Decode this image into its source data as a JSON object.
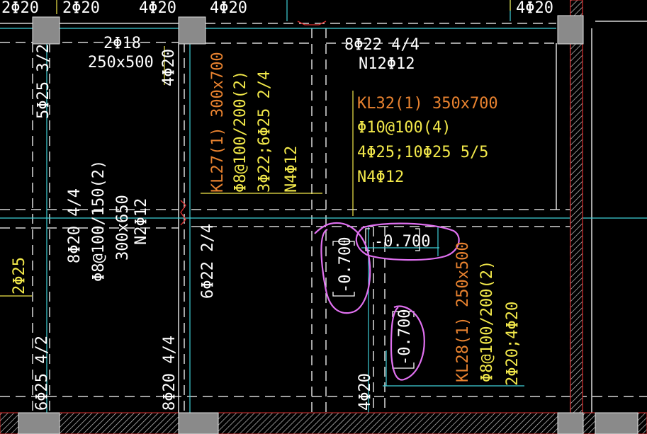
{
  "colors": {
    "background": "#000000",
    "white": "#ffffff",
    "orange": "#e8822f",
    "yellow": "#f2e84a",
    "cyan": "#3fd0d8",
    "red": "#e03030",
    "magenta": "#e070f0",
    "column_fill": "#8a8a8a"
  },
  "top_labels": {
    "a": "2Φ20",
    "b": "2Φ20",
    "c": "4Φ20",
    "d": "4Φ20"
  },
  "beam_left": {
    "top_bars": "2Φ18",
    "size": "250x500",
    "side_left_top": "5Φ25 3/2",
    "side_right": "4Φ20"
  },
  "beam_mid_vertical": {
    "line1": "8Φ20 4/4",
    "line2": "Φ8@100/150(2)",
    "line3": "300x650",
    "line4": "N2Φ12"
  },
  "left_small": {
    "yellow_bar": "2Φ25",
    "bottom_bar": "6Φ25 4/2",
    "bottom_mid": "8Φ20 4/4",
    "bottom_col": "8Φ20 4/4"
  },
  "kl27": {
    "name": "KL27(1) 300x700",
    "stirrup": "Φ8@100/200(2)",
    "bars": "3Φ22;6Φ25 2/4",
    "waist": "N4Φ12"
  },
  "kl27_bottom": "6Φ22 2/4",
  "top_right_beam": {
    "line1": "8Φ22 4/4",
    "line2": "N12Φ12"
  },
  "kl32": {
    "name": "KL32(1) 350x700",
    "stirrup": "Φ10@100(4)",
    "bars": "4Φ25;10Φ25 5/5",
    "waist": "N4Φ12"
  },
  "elevations": {
    "a": "-0.700",
    "b": "-0.700",
    "c": "-0.700"
  },
  "kl28": {
    "name": "KL28(1) 250x500",
    "stirrup": "Φ8@100/200(2)",
    "bars": "2Φ20;4Φ20"
  },
  "kl28_left": "4Φ20"
}
